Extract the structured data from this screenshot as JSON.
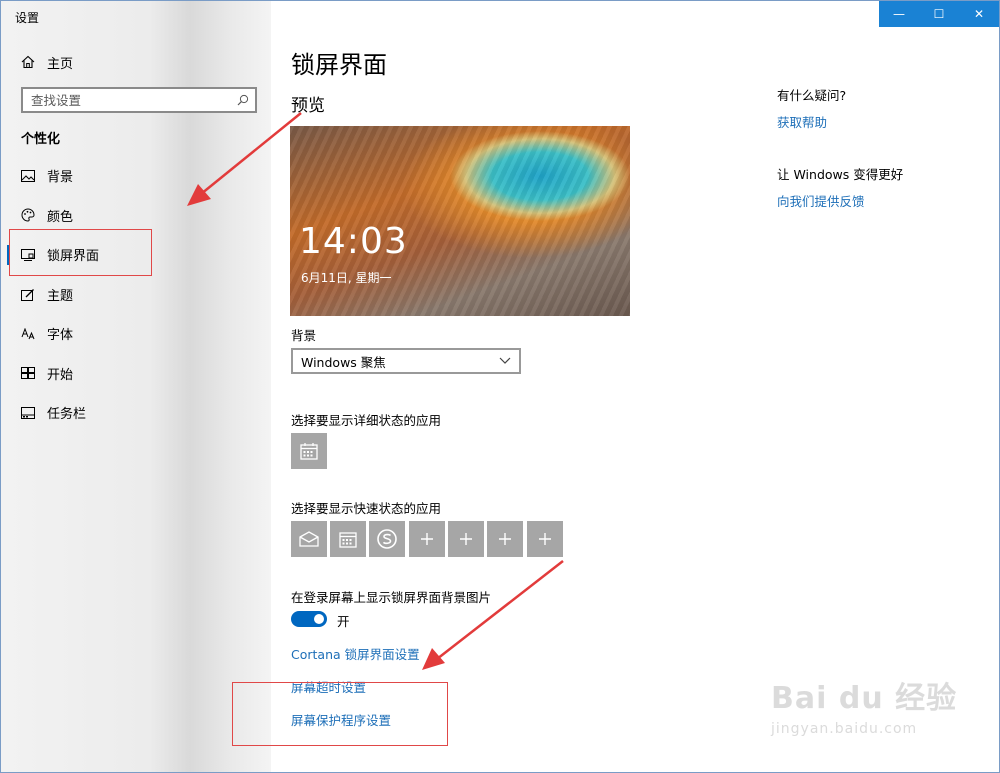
{
  "window": {
    "title": "设置",
    "controls": {
      "minimize": "—",
      "maximize": "☐",
      "close": "✕"
    }
  },
  "sidebar": {
    "home_label": "主页",
    "search_placeholder": "查找设置",
    "section_title": "个性化",
    "items": [
      {
        "label": "背景",
        "icon": "image-icon"
      },
      {
        "label": "颜色",
        "icon": "palette-icon"
      },
      {
        "label": "锁屏界面",
        "icon": "lockscreen-icon",
        "active": true
      },
      {
        "label": "主题",
        "icon": "theme-icon"
      },
      {
        "label": "字体",
        "icon": "font-icon"
      },
      {
        "label": "开始",
        "icon": "start-icon"
      },
      {
        "label": "任务栏",
        "icon": "taskbar-icon"
      }
    ]
  },
  "main": {
    "title": "锁屏界面",
    "preview_title": "预览",
    "preview": {
      "time": "14:03",
      "date": "6月11日, 星期一"
    },
    "background_label": "背景",
    "background_value": "Windows 聚焦",
    "detailed_status_label": "选择要显示详细状态的应用",
    "quick_status_label": "选择要显示快速状态的应用",
    "signin_bg_label": "在登录屏幕上显示锁屏界面背景图片",
    "toggle_state": "开",
    "links": {
      "cortana": "Cortana 锁屏界面设置",
      "timeout": "屏幕超时设置",
      "screensaver": "屏幕保护程序设置"
    }
  },
  "aside": {
    "help_question": "有什么疑问?",
    "help_link": "获取帮助",
    "improve_title": "让 Windows 变得更好",
    "feedback_link": "向我们提供反馈"
  },
  "watermark": {
    "logo": "Bai du 经验",
    "url": "jingyan.baidu.com"
  },
  "colors": {
    "accent": "#0067c0",
    "link": "#1e6fb8",
    "annotation": "#e04848",
    "tile": "#a6a6a6"
  }
}
